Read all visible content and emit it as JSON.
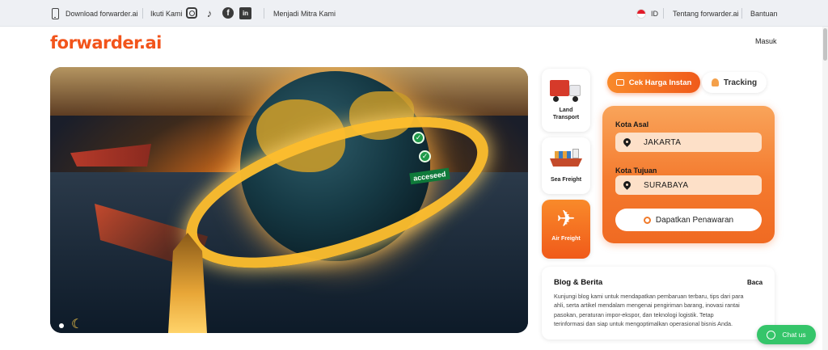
{
  "topbar": {
    "download": "Download forwarder.ai",
    "follow": "Ikuti Kami",
    "social": {
      "instagram_icon": "instagram-icon",
      "tiktok_glyph": "♪",
      "facebook_glyph": "f",
      "linkedin_glyph": "in"
    },
    "partner": "Menjadi Mitra Kami",
    "language": "ID",
    "about": "Tentang forwarder.ai",
    "help": "Bantuan"
  },
  "header": {
    "logo": "forwarder.ai",
    "login": "Masuk"
  },
  "hero": {
    "badge": "acceseed",
    "check_glyph": "✓",
    "moon_glyph": "☾"
  },
  "services": [
    {
      "label": "Land Transport",
      "icon": "truck-icon"
    },
    {
      "label": "Sea Freight",
      "icon": "ship-icon"
    },
    {
      "label": "Air Freight",
      "icon": "plane-icon",
      "glyph": "✈"
    }
  ],
  "tabs": {
    "instant_price": "Cek Harga Instan",
    "tracking": "Tracking"
  },
  "form": {
    "origin_label": "Kota Asal",
    "origin_value": "JAKARTA",
    "destination_label": "Kota Tujuan",
    "destination_value": "SURABAYA",
    "submit": "Dapatkan Penawaran"
  },
  "blog": {
    "title": "Blog & Berita",
    "read": "Baca",
    "text": "Kunjungi blog kami untuk mendapatkan pembaruan terbaru, tips dari para ahli, serta artikel mendalam mengenai pengiriman barang, inovasi rantai pasokan, peraturan impor-ekspor, dan teknologi logistik. Tetap terinformasi dan siap untuk mengoptimalkan operasional bisnis Anda."
  },
  "chat": {
    "label": "Chat us"
  },
  "colors": {
    "brand": "#f2541b",
    "accent_gradient_start": "#f98a2a",
    "accent_gradient_end": "#f05a1a",
    "chat": "#35c56a"
  }
}
